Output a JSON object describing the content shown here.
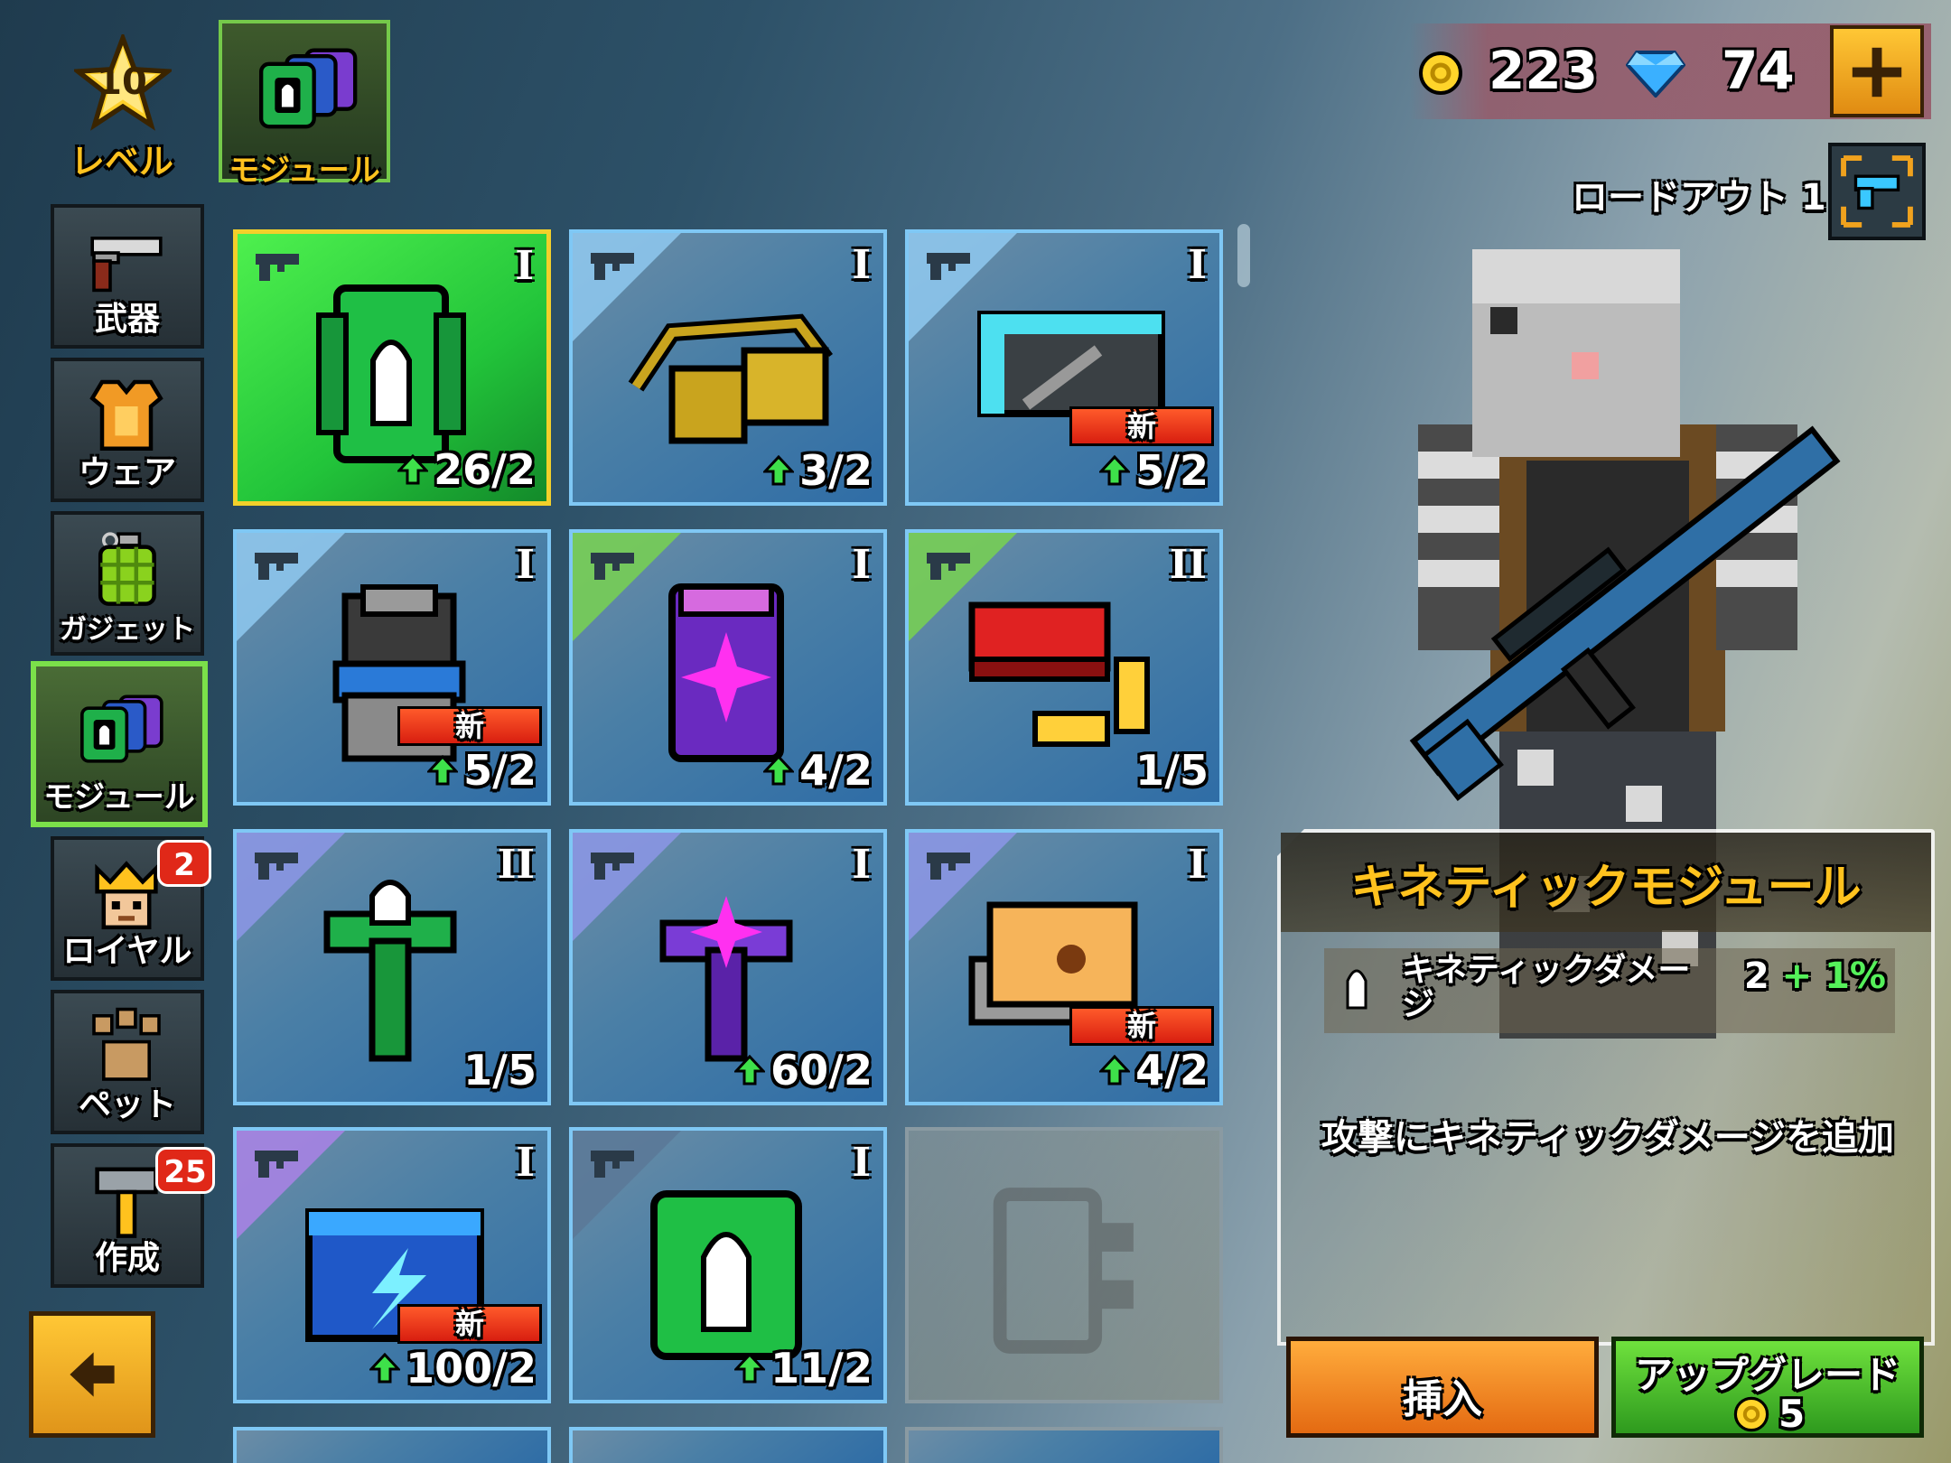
{
  "level": {
    "value": "10",
    "label": "レベル"
  },
  "top_tab": {
    "label": "モジュール"
  },
  "sidebar": {
    "items": [
      {
        "label": "武器",
        "icon": "pistol-icon"
      },
      {
        "label": "ウェア",
        "icon": "armor-icon"
      },
      {
        "label": "ガジェット",
        "icon": "grenade-icon"
      },
      {
        "label": "モジュール",
        "icon": "module-icon",
        "active": true
      },
      {
        "label": "ロイヤル",
        "icon": "crown-icon",
        "badge": "2"
      },
      {
        "label": "ペット",
        "icon": "paw-icon"
      },
      {
        "label": "作成",
        "icon": "hammer-icon",
        "badge": "25"
      }
    ]
  },
  "currency": {
    "coins": "223",
    "gems": "74"
  },
  "loadout": {
    "label": "ロードアウト 1"
  },
  "modules": [
    {
      "rank": "I",
      "progress": "26/2",
      "arrow": true,
      "new": false,
      "selected": true,
      "art": "green-bullet-module"
    },
    {
      "rank": "I",
      "progress": "3/2",
      "arrow": true,
      "new": false,
      "art": "yellow-belt-module"
    },
    {
      "rank": "I",
      "progress": "5/2",
      "arrow": true,
      "new": true,
      "art": "cyan-frame-module"
    },
    {
      "rank": "I",
      "progress": "5/2",
      "arrow": true,
      "new": true,
      "art": "blue-fist-module"
    },
    {
      "rank": "I",
      "progress": "4/2",
      "arrow": true,
      "new": false,
      "art": "purple-star-module"
    },
    {
      "rank": "II",
      "progress": "1/5",
      "arrow": false,
      "new": false,
      "art": "ammo-box-module"
    },
    {
      "rank": "II",
      "progress": "1/5",
      "arrow": false,
      "new": false,
      "art": "green-mount-module"
    },
    {
      "rank": "I",
      "progress": "60/2",
      "arrow": true,
      "new": false,
      "art": "purple-mount-module"
    },
    {
      "rank": "I",
      "progress": "4/2",
      "arrow": true,
      "new": true,
      "art": "book-module"
    },
    {
      "rank": "I",
      "progress": "100/2",
      "arrow": true,
      "new": true,
      "art": "lightning-module"
    },
    {
      "rank": "I",
      "progress": "11/2",
      "arrow": true,
      "new": false,
      "art": "green-bullet-large-module"
    },
    {
      "rank": "",
      "progress": "",
      "arrow": false,
      "new": false,
      "empty": true
    }
  ],
  "new_label": "新",
  "panel": {
    "title": "キネティックモジュール",
    "stat_name": "キネティックダメージ",
    "stat_value": "2",
    "stat_bonus": "+ 1%",
    "description": "攻撃にキネティックダメージを追加",
    "insert_label": "挿入",
    "upgrade_label": "アップグレード",
    "upgrade_cost": "5"
  },
  "colors": {
    "accent_gold": "#ffc21e",
    "active_green": "#7be04a",
    "new_red": "#e02818",
    "tile_blue": "#7fc8f5"
  }
}
